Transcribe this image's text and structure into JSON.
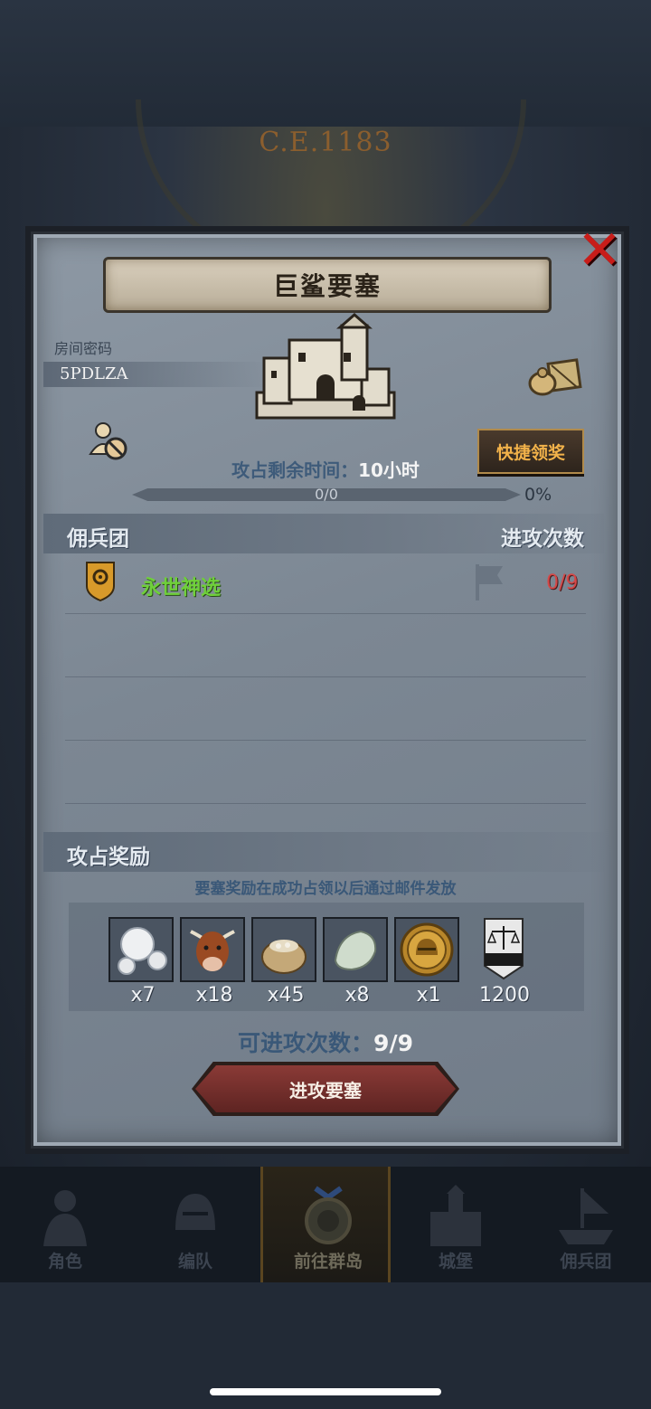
{
  "era": "C.E.1183",
  "dialog": {
    "title": "巨鲨要塞",
    "room_label": "房间密码",
    "room_code": "5PDLZA",
    "quick_claim": "快捷领奖",
    "time_label": "攻占剩余时间：",
    "time_value": "10小时",
    "progress_text": "0/0",
    "progress_percent": "0%",
    "progress_fraction": 0
  },
  "mercenary_section": {
    "left_header": "佣兵团",
    "right_header": "进攻次数",
    "rows": [
      {
        "name": "永世神选",
        "attacks": "0/9"
      }
    ]
  },
  "reward_section": {
    "header": "攻占奖励",
    "note": "要塞奖励在成功占领以后通过邮件发放",
    "items": [
      {
        "icon": "pearl-icon",
        "count": "x7"
      },
      {
        "icon": "cow-icon",
        "count": "x18"
      },
      {
        "icon": "sack-icon",
        "count": "x45"
      },
      {
        "icon": "stone-icon",
        "count": "x8"
      },
      {
        "icon": "helmet-coin-icon",
        "count": "x1"
      },
      {
        "icon": "justice-banner-icon",
        "count": "1200"
      }
    ]
  },
  "attempts_label": "可进攻次数：",
  "attempts_value": "9/9",
  "attack_button": "进攻要塞",
  "nav": [
    {
      "label": "角色"
    },
    {
      "label": "编队"
    },
    {
      "label": "前往群岛"
    },
    {
      "label": "城堡"
    },
    {
      "label": "佣兵团"
    }
  ],
  "colors": {
    "panel": "#7c8793",
    "team_name": "#6fd03a",
    "attack_count": "#d44848",
    "quick_button_text": "#f2b24a",
    "attack_button": "#8a3a36"
  }
}
